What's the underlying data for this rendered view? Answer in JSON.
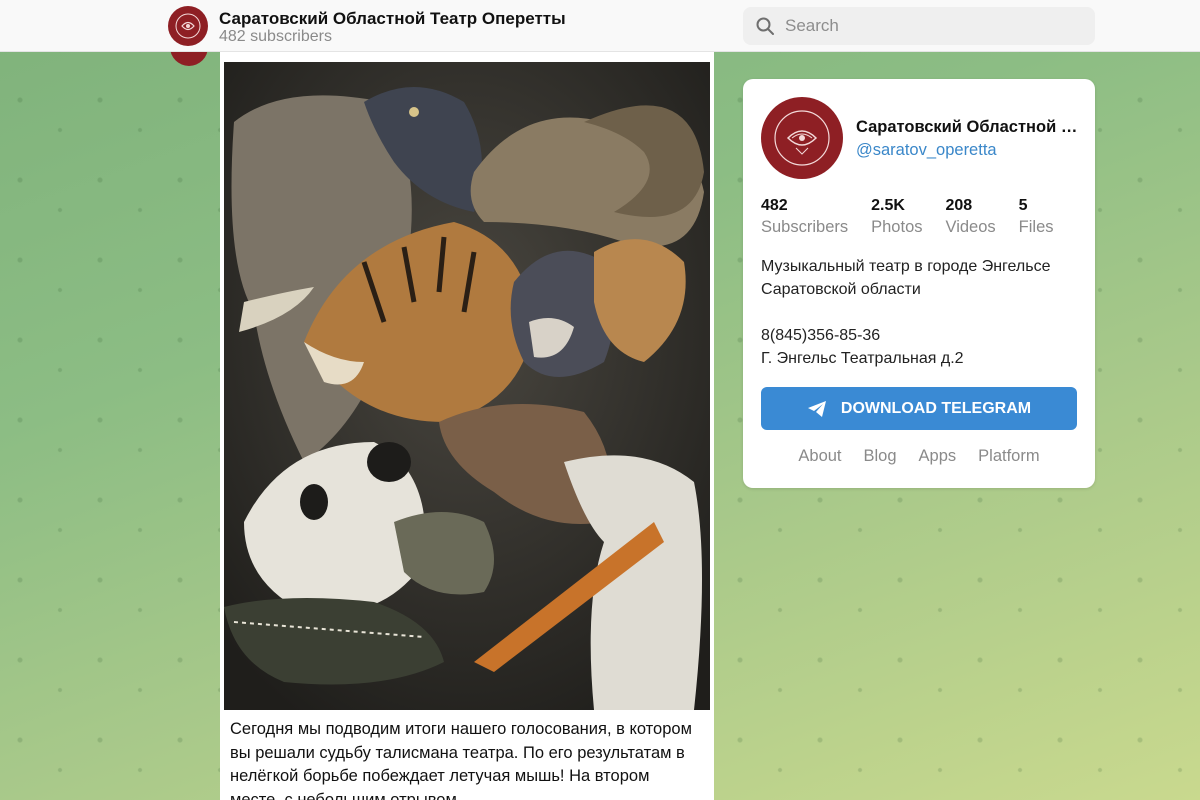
{
  "header": {
    "channel_title": "Саратовский Областной Театр Оперетты",
    "subscribers_text": "482 subscribers",
    "search_placeholder": "Search"
  },
  "post": {
    "image_alt": "animals illustration",
    "text": "Сегодня мы подводим итоги нашего голосования, в котором вы решали судьбу талисмана театра. По его результатам в нелёгкой борьбе побеждает летучая мышь! На втором месте, с небольшим отрывом,"
  },
  "card": {
    "name": "Саратовский Областной Театр Оперетты",
    "handle": "@saratov_operetta",
    "stats": [
      {
        "value": "482",
        "label": "Subscribers"
      },
      {
        "value": "2.5K",
        "label": "Photos"
      },
      {
        "value": "208",
        "label": "Videos"
      },
      {
        "value": "5",
        "label": "Files"
      }
    ],
    "description": "Музыкальный театр в городе Энгельсе Саратовской области",
    "phone": "8(845)356-85-36",
    "address": "Г. Энгельс Театральная д.2",
    "download_label": "DOWNLOAD TELEGRAM",
    "links": [
      "About",
      "Blog",
      "Apps",
      "Platform"
    ]
  },
  "colors": {
    "accent": "#3a8ad4",
    "link": "#3a87c9",
    "avatar_bg": "#8e1f24"
  }
}
